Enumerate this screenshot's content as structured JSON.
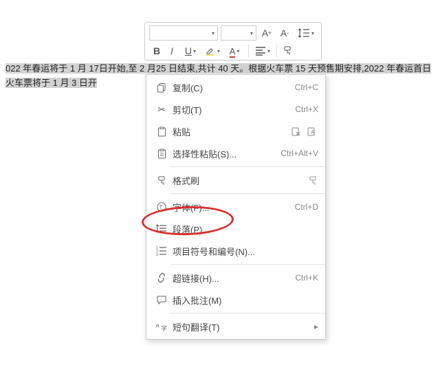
{
  "toolbar": {
    "font_name": "",
    "font_size": "",
    "increase_font": "A⁺",
    "decrease_font": "A⁻",
    "bold": "B",
    "italic": "I",
    "underline": "U"
  },
  "document": {
    "selected_text": "022 年春运将于 1 月 17日开始,至 2 月25 日结束,共计 40 天。根据火车票 15 天预售期安排,2022 年春运首日火车票将于 1 月 3 日开"
  },
  "context_menu": {
    "copy": {
      "label": "复制(C)",
      "shortcut": "Ctrl+C"
    },
    "cut": {
      "label": "剪切(T)",
      "shortcut": "Ctrl+X"
    },
    "paste": {
      "label": "粘贴",
      "shortcut": ""
    },
    "paste_special": {
      "label": "选择性粘贴(S)...",
      "shortcut": "Ctrl+Alt+V"
    },
    "format_painter": {
      "label": "格式刷",
      "shortcut": ""
    },
    "font": {
      "label": "字体(F)...",
      "shortcut": "Ctrl+D"
    },
    "paragraph": {
      "label": "段落(P)...",
      "shortcut": ""
    },
    "bullets": {
      "label": "项目符号和编号(N)...",
      "shortcut": ""
    },
    "hyperlink": {
      "label": "超链接(H)...",
      "shortcut": "Ctrl+K"
    },
    "insert_comment": {
      "label": "插入批注(M)",
      "shortcut": ""
    },
    "translate": {
      "label": "短句翻译(T)",
      "shortcut": ""
    }
  }
}
